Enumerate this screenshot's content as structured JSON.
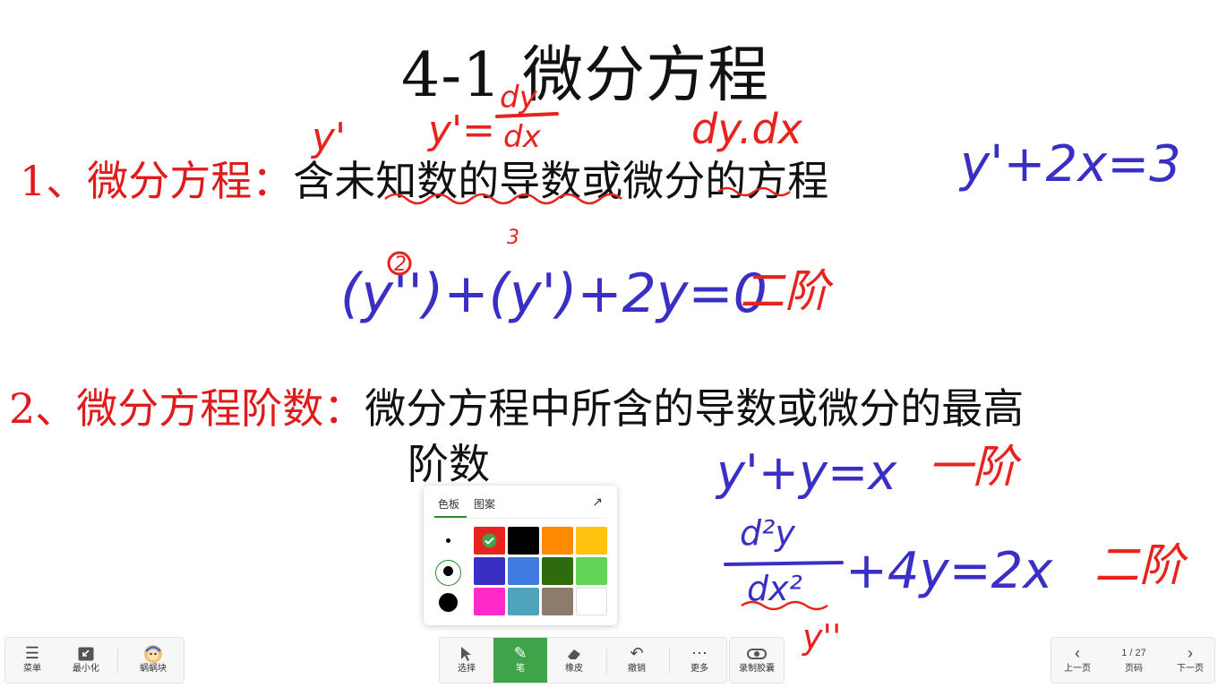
{
  "slide": {
    "title": "4-1 微分方程",
    "def1_label": "1、微分方程：",
    "def1_text": "含未知数的导数或微分的方程",
    "def2_label": "2、微分方程阶数：",
    "def2_text": "微分方程中所含的导数或微分的最高",
    "def2_text_cont": "阶数"
  },
  "annotations": {
    "y_prime": "y'",
    "y_prime_eq": "y'=",
    "dy": "dy",
    "dx": "dx",
    "dy_dx": "dy.dx",
    "eq1": "y'+2x=3",
    "eq2": "(y'')+(y')+2y=0",
    "exp2": "2",
    "exp3": "3",
    "order2": "二阶",
    "eq3": "y'+y=x",
    "order1": "一阶",
    "d2y": "d²y",
    "dx2": "dx²",
    "eq4_rest": "+4y=2x",
    "order2b": "二阶",
    "ypp": "y''"
  },
  "palette": {
    "tab_color": "色板",
    "tab_pattern": "图案",
    "selected_color": "#e8231e",
    "colors": [
      "#e8231e",
      "#000000",
      "#ff8a00",
      "#ffc20e",
      "#3a2fc4",
      "#3f7be0",
      "#2e6b0e",
      "#62d457",
      "#ff2ac8",
      "#4fa3bd",
      "#8c7c6c",
      "#ffffff"
    ]
  },
  "toolbar_left": {
    "menu": "菜单",
    "minimize": "最小化",
    "snail": "蜗蜗块"
  },
  "toolbar_center": {
    "select": "选择",
    "pen": "笔",
    "eraser": "橡皮",
    "undo": "撤销",
    "more": "更多",
    "record": "录制胶囊"
  },
  "toolbar_right": {
    "prev": "上一页",
    "page_indicator": "1 / 27",
    "page_label": "页码",
    "next": "下一页"
  },
  "ink_colors": {
    "red": "#e8231e",
    "blue": "#3a2fc4"
  }
}
